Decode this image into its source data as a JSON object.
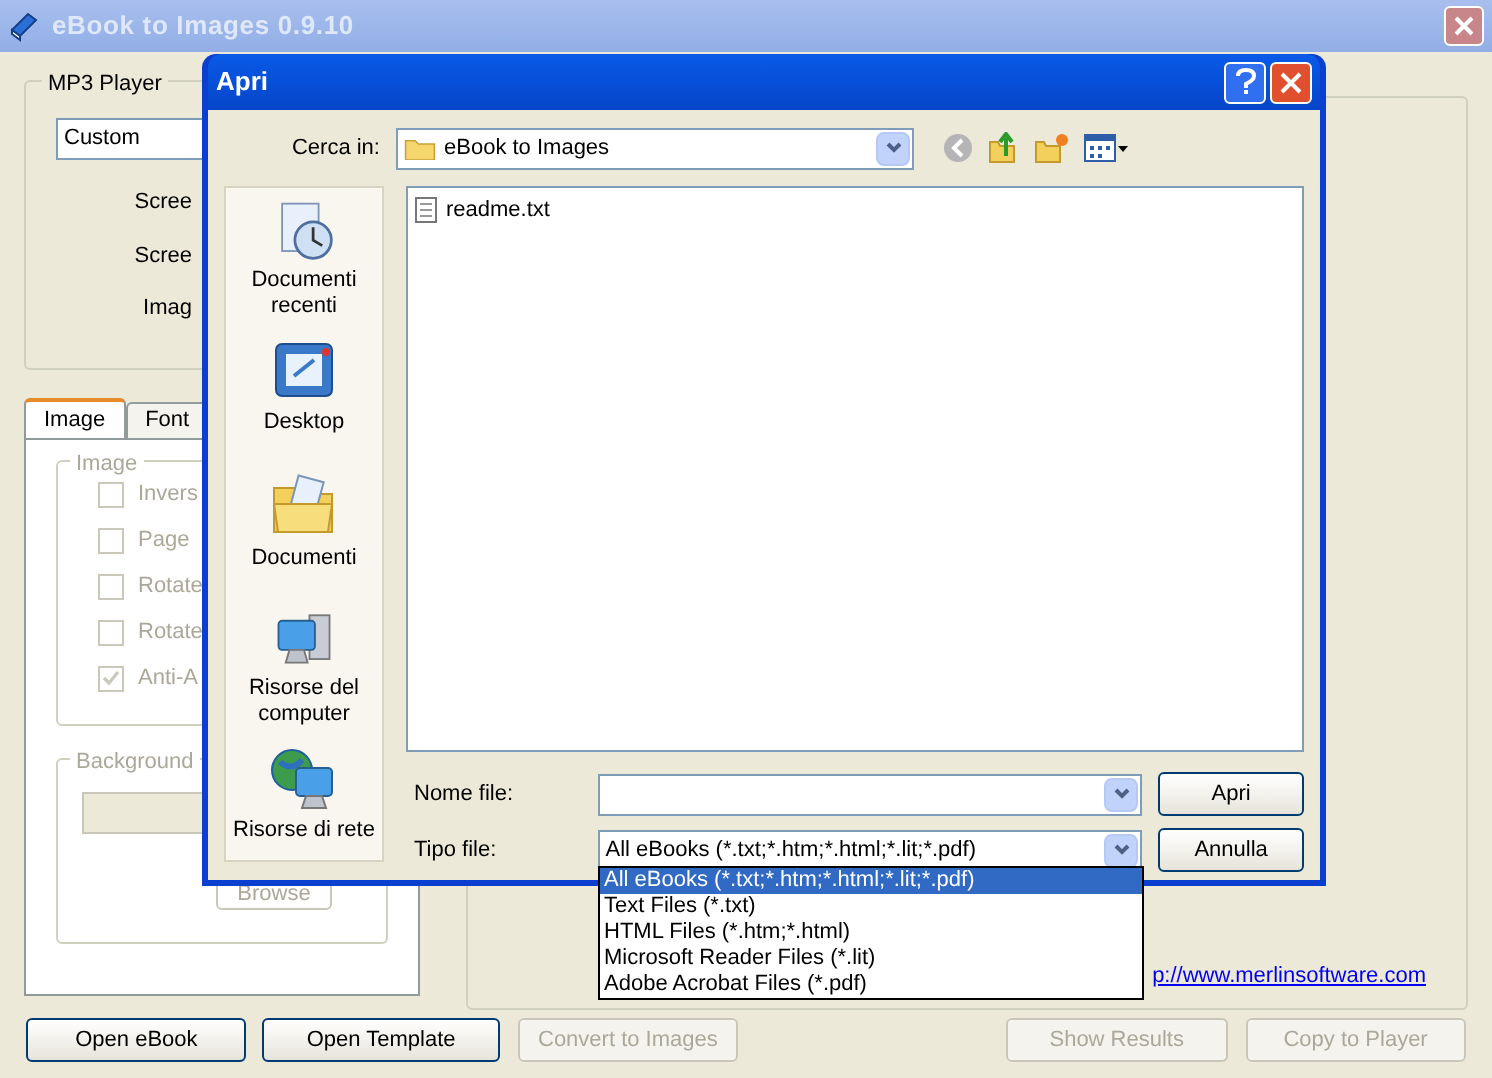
{
  "main_window": {
    "title": "eBook to Images 0.9.10"
  },
  "mp3_player": {
    "label": "MP3 Player",
    "preset": "Custom",
    "fields": [
      {
        "label": "Scree"
      },
      {
        "label": "Scree"
      },
      {
        "label": "Imag"
      }
    ]
  },
  "tabs": [
    {
      "label": "Image",
      "selected": true
    },
    {
      "label": "Font",
      "selected": false
    }
  ],
  "image_group": {
    "label": "Image",
    "disabled": true,
    "options": [
      {
        "label": "Invers",
        "checked": false
      },
      {
        "label": "Page",
        "checked": false
      },
      {
        "label": "Rotate",
        "checked": false
      },
      {
        "label": "Rotate",
        "checked": false
      },
      {
        "label": "Anti-A",
        "checked": true
      }
    ]
  },
  "background_group": {
    "label": "Background",
    "disabled": true,
    "button": "Browse"
  },
  "link": "p://www.merlinsoftware.com",
  "buttons": [
    {
      "label": "Open eBook",
      "disabled": false
    },
    {
      "label": "Open Template",
      "disabled": false
    },
    {
      "label": "Convert to Images",
      "disabled": true
    },
    {
      "label": "Show Results",
      "disabled": true
    },
    {
      "label": "Copy to Player",
      "disabled": true
    }
  ],
  "dialog": {
    "title": "Apri",
    "look_in_label": "Cerca in:",
    "look_in": "eBook to Images",
    "places": [
      {
        "label": "Documenti recenti",
        "kind": "recent"
      },
      {
        "label": "Desktop",
        "kind": "desktop"
      },
      {
        "label": "Documenti",
        "kind": "documents"
      },
      {
        "label": "Risorse del computer",
        "kind": "computer"
      },
      {
        "label": "Risorse di rete",
        "kind": "network"
      }
    ],
    "files": [
      {
        "name": "readme.txt"
      }
    ],
    "file_name_label": "Nome file:",
    "file_type_label": "Tipo file:",
    "file_type": "All eBooks (*.txt;*.htm;*.html;*.lit;*.pdf)",
    "open_button": "Apri",
    "cancel_button": "Annulla",
    "file_type_options": [
      {
        "label": "All eBooks (*.txt;*.htm;*.html;*.lit;*.pdf)",
        "selected": true
      },
      {
        "label": "Text Files (*.txt)",
        "selected": false
      },
      {
        "label": "HTML Files (*.htm;*.html)",
        "selected": false
      },
      {
        "label": "Microsoft Reader Files (*.lit)",
        "selected": false
      },
      {
        "label": "Adobe Acrobat Files (*.pdf)",
        "selected": false
      }
    ]
  }
}
